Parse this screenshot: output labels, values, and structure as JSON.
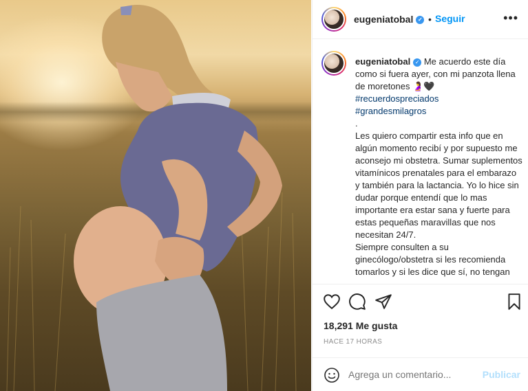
{
  "post": {
    "username": "eugeniatobal",
    "follow_label": "Seguir",
    "dot": "•",
    "more": "•••",
    "caption": {
      "line1": "Me acuerdo este día como si fuera ayer, con mi panzota llena de moretones 🤰🖤",
      "hashtag1": "#recuerdospreciados",
      "hashtag2": "#grandesmilagros",
      "dot": ".",
      "paragraph1": "Les quiero compartir esta info que en algún momento recibí y por supuesto me aconsejo mi obstetra. Sumar suplementos vitamínicos prenatales para el embarazo y también para la lactancia. Yo lo hice sin dudar porque entendí que lo mas importante era estar sana y fuerte para estas pequeñas maravillas que nos necesitan 24/7.",
      "paragraph2": "Siempre consulten a su ginecólogo/obstetra si les recomienda tomarlos y si les dice que sí, no tengan"
    },
    "likes": "18,291 Me gusta",
    "time": "HACE 17 HORAS",
    "comment_placeholder": "Agrega un comentario...",
    "publish_label": "Publicar"
  },
  "icons": {
    "heart": "heart-icon",
    "comment": "comment-icon",
    "share": "paper-plane-icon",
    "save": "bookmark-icon",
    "emoji": "smiley-icon",
    "verified": "verified-badge-icon"
  },
  "colors": {
    "link": "#0095f6",
    "hashtag": "#00376b",
    "muted": "#8e8e8e",
    "publish_disabled": "#b2dffc"
  }
}
